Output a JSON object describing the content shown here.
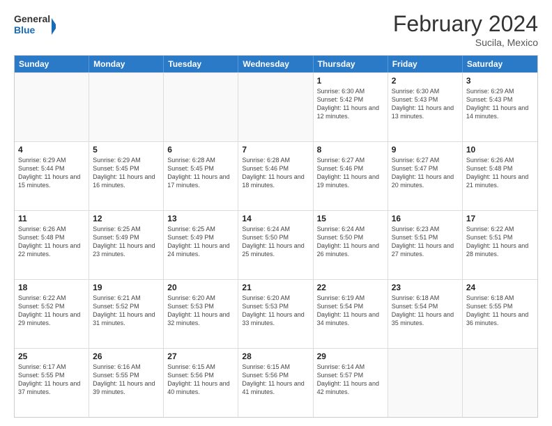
{
  "header": {
    "logo_general": "General",
    "logo_blue": "Blue",
    "month": "February 2024",
    "location": "Sucila, Mexico"
  },
  "days_of_week": [
    "Sunday",
    "Monday",
    "Tuesday",
    "Wednesday",
    "Thursday",
    "Friday",
    "Saturday"
  ],
  "rows": [
    [
      {
        "day": "",
        "info": ""
      },
      {
        "day": "",
        "info": ""
      },
      {
        "day": "",
        "info": ""
      },
      {
        "day": "",
        "info": ""
      },
      {
        "day": "1",
        "info": "Sunrise: 6:30 AM\nSunset: 5:42 PM\nDaylight: 11 hours and 12 minutes."
      },
      {
        "day": "2",
        "info": "Sunrise: 6:30 AM\nSunset: 5:43 PM\nDaylight: 11 hours and 13 minutes."
      },
      {
        "day": "3",
        "info": "Sunrise: 6:29 AM\nSunset: 5:43 PM\nDaylight: 11 hours and 14 minutes."
      }
    ],
    [
      {
        "day": "4",
        "info": "Sunrise: 6:29 AM\nSunset: 5:44 PM\nDaylight: 11 hours and 15 minutes."
      },
      {
        "day": "5",
        "info": "Sunrise: 6:29 AM\nSunset: 5:45 PM\nDaylight: 11 hours and 16 minutes."
      },
      {
        "day": "6",
        "info": "Sunrise: 6:28 AM\nSunset: 5:45 PM\nDaylight: 11 hours and 17 minutes."
      },
      {
        "day": "7",
        "info": "Sunrise: 6:28 AM\nSunset: 5:46 PM\nDaylight: 11 hours and 18 minutes."
      },
      {
        "day": "8",
        "info": "Sunrise: 6:27 AM\nSunset: 5:46 PM\nDaylight: 11 hours and 19 minutes."
      },
      {
        "day": "9",
        "info": "Sunrise: 6:27 AM\nSunset: 5:47 PM\nDaylight: 11 hours and 20 minutes."
      },
      {
        "day": "10",
        "info": "Sunrise: 6:26 AM\nSunset: 5:48 PM\nDaylight: 11 hours and 21 minutes."
      }
    ],
    [
      {
        "day": "11",
        "info": "Sunrise: 6:26 AM\nSunset: 5:48 PM\nDaylight: 11 hours and 22 minutes."
      },
      {
        "day": "12",
        "info": "Sunrise: 6:25 AM\nSunset: 5:49 PM\nDaylight: 11 hours and 23 minutes."
      },
      {
        "day": "13",
        "info": "Sunrise: 6:25 AM\nSunset: 5:49 PM\nDaylight: 11 hours and 24 minutes."
      },
      {
        "day": "14",
        "info": "Sunrise: 6:24 AM\nSunset: 5:50 PM\nDaylight: 11 hours and 25 minutes."
      },
      {
        "day": "15",
        "info": "Sunrise: 6:24 AM\nSunset: 5:50 PM\nDaylight: 11 hours and 26 minutes."
      },
      {
        "day": "16",
        "info": "Sunrise: 6:23 AM\nSunset: 5:51 PM\nDaylight: 11 hours and 27 minutes."
      },
      {
        "day": "17",
        "info": "Sunrise: 6:22 AM\nSunset: 5:51 PM\nDaylight: 11 hours and 28 minutes."
      }
    ],
    [
      {
        "day": "18",
        "info": "Sunrise: 6:22 AM\nSunset: 5:52 PM\nDaylight: 11 hours and 29 minutes."
      },
      {
        "day": "19",
        "info": "Sunrise: 6:21 AM\nSunset: 5:52 PM\nDaylight: 11 hours and 31 minutes."
      },
      {
        "day": "20",
        "info": "Sunrise: 6:20 AM\nSunset: 5:53 PM\nDaylight: 11 hours and 32 minutes."
      },
      {
        "day": "21",
        "info": "Sunrise: 6:20 AM\nSunset: 5:53 PM\nDaylight: 11 hours and 33 minutes."
      },
      {
        "day": "22",
        "info": "Sunrise: 6:19 AM\nSunset: 5:54 PM\nDaylight: 11 hours and 34 minutes."
      },
      {
        "day": "23",
        "info": "Sunrise: 6:18 AM\nSunset: 5:54 PM\nDaylight: 11 hours and 35 minutes."
      },
      {
        "day": "24",
        "info": "Sunrise: 6:18 AM\nSunset: 5:55 PM\nDaylight: 11 hours and 36 minutes."
      }
    ],
    [
      {
        "day": "25",
        "info": "Sunrise: 6:17 AM\nSunset: 5:55 PM\nDaylight: 11 hours and 37 minutes."
      },
      {
        "day": "26",
        "info": "Sunrise: 6:16 AM\nSunset: 5:55 PM\nDaylight: 11 hours and 39 minutes."
      },
      {
        "day": "27",
        "info": "Sunrise: 6:15 AM\nSunset: 5:56 PM\nDaylight: 11 hours and 40 minutes."
      },
      {
        "day": "28",
        "info": "Sunrise: 6:15 AM\nSunset: 5:56 PM\nDaylight: 11 hours and 41 minutes."
      },
      {
        "day": "29",
        "info": "Sunrise: 6:14 AM\nSunset: 5:57 PM\nDaylight: 11 hours and 42 minutes."
      },
      {
        "day": "",
        "info": ""
      },
      {
        "day": "",
        "info": ""
      }
    ]
  ]
}
